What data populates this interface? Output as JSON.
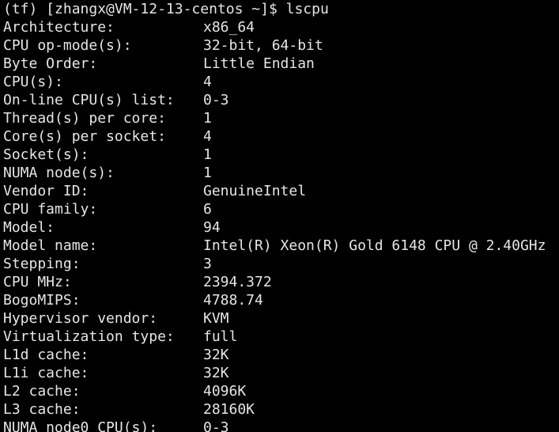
{
  "terminal": {
    "prompt": "(tf) [zhangx@VM-12-13-centos ~]$ lscpu",
    "rows": [
      {
        "key": "Architecture:",
        "value": "x86_64"
      },
      {
        "key": "CPU op-mode(s):",
        "value": "32-bit, 64-bit"
      },
      {
        "key": "Byte Order:",
        "value": "Little Endian"
      },
      {
        "key": "CPU(s):",
        "value": "4"
      },
      {
        "key": "On-line CPU(s) list:",
        "value": "0-3"
      },
      {
        "key": "Thread(s) per core:",
        "value": "1"
      },
      {
        "key": "Core(s) per socket:",
        "value": "4"
      },
      {
        "key": "Socket(s):",
        "value": "1"
      },
      {
        "key": "NUMA node(s):",
        "value": "1"
      },
      {
        "key": "Vendor ID:",
        "value": "GenuineIntel"
      },
      {
        "key": "CPU family:",
        "value": "6"
      },
      {
        "key": "Model:",
        "value": "94"
      },
      {
        "key": "Model name:",
        "value": "Intel(R) Xeon(R) Gold 6148 CPU @ 2.40GHz"
      },
      {
        "key": "Stepping:",
        "value": "3"
      },
      {
        "key": "CPU MHz:",
        "value": "2394.372"
      },
      {
        "key": "BogoMIPS:",
        "value": "4788.74"
      },
      {
        "key": "Hypervisor vendor:",
        "value": "KVM"
      },
      {
        "key": "Virtualization type:",
        "value": "full"
      },
      {
        "key": "L1d cache:",
        "value": "32K"
      },
      {
        "key": "L1i cache:",
        "value": "32K"
      },
      {
        "key": "L2 cache:",
        "value": "4096K"
      },
      {
        "key": "L3 cache:",
        "value": "28160K"
      },
      {
        "key": "NUMA node0 CPU(s):",
        "value": "0-3"
      }
    ]
  }
}
